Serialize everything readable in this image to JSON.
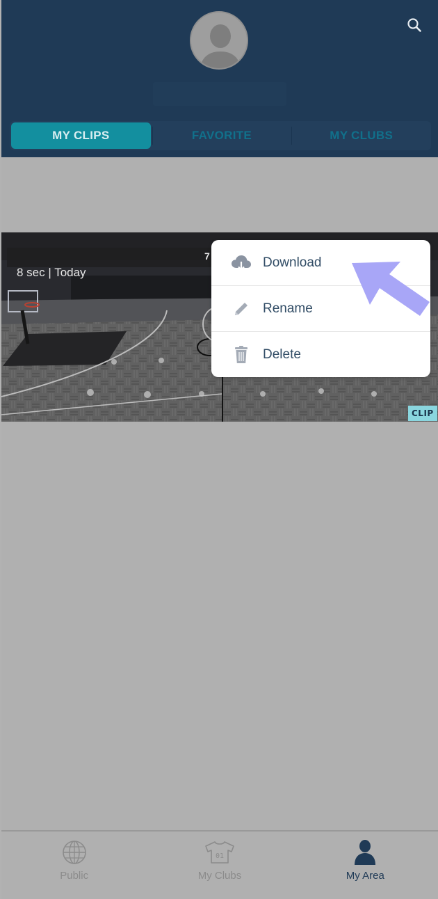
{
  "header": {
    "search_icon": "search-icon",
    "avatar_icon": "user-avatar-placeholder"
  },
  "tabs": [
    {
      "label": "MY CLIPS",
      "active": true
    },
    {
      "label": "FAVORITE",
      "active": false
    },
    {
      "label": "MY CLUBS",
      "active": false
    }
  ],
  "clip": {
    "title_fragment": "7",
    "meta": "8 sec | Today",
    "badge": "CLIP"
  },
  "context_menu": {
    "items": [
      {
        "label": "Download",
        "icon": "cloud-download-icon"
      },
      {
        "label": "Rename",
        "icon": "pencil-icon"
      },
      {
        "label": "Delete",
        "icon": "trash-icon"
      }
    ]
  },
  "bottom_nav": {
    "items": [
      {
        "label": "Public",
        "icon": "globe-icon",
        "active": false
      },
      {
        "label": "My Clubs",
        "icon": "jersey-icon",
        "active": false
      },
      {
        "label": "My Area",
        "icon": "person-icon",
        "active": true
      }
    ]
  },
  "colors": {
    "header_bg": "#1f3a56",
    "tab_active": "#138f9f",
    "accent_arrow": "#a8a6f7",
    "overlay_bg": "#b0b0b0"
  }
}
